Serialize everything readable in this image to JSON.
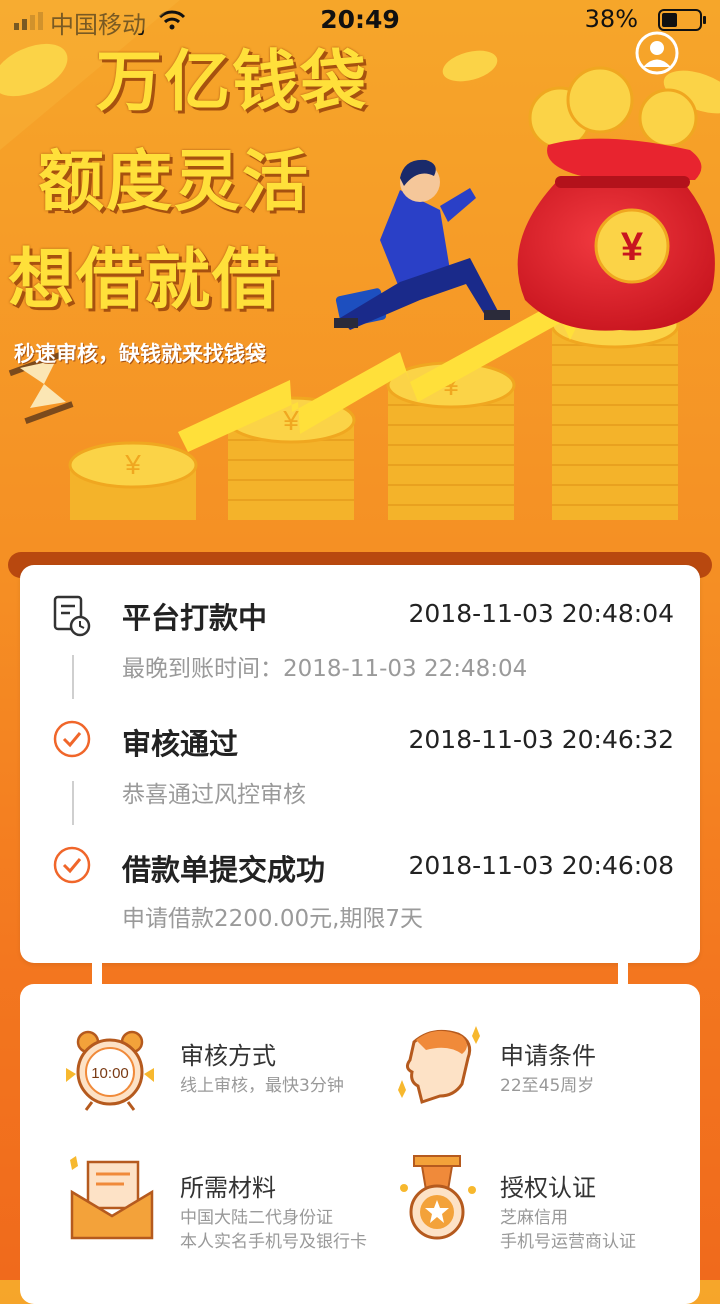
{
  "status_bar": {
    "carrier": "中国移动",
    "time": "20:49",
    "battery": "38%"
  },
  "banner": {
    "line1": "万亿钱袋",
    "line2": "额度灵活",
    "line3": "想借就借",
    "subtitle": "秒速审核，缺钱就来找钱袋",
    "bag_symbol": "¥",
    "coin_symbol": "¥"
  },
  "progress": {
    "steps": [
      {
        "title": "平台打款中",
        "time": "2018-11-03 20:48:04",
        "desc": "最晚到账时间：2018-11-03 22:48:04",
        "icon": "document-clock-icon"
      },
      {
        "title": "审核通过",
        "time": "2018-11-03 20:46:32",
        "desc": "恭喜通过风控审核",
        "icon": "check-circle-icon"
      },
      {
        "title": "借款单提交成功",
        "time": "2018-11-03 20:46:08",
        "desc": "申请借款2200.00元,期限7天",
        "icon": "check-circle-icon"
      }
    ]
  },
  "info": {
    "items": [
      {
        "title": "审核方式",
        "desc1": "线上审核，最快3分钟",
        "desc2": "",
        "icon": "alarm-clock-icon",
        "clock_text": "10:00"
      },
      {
        "title": "申请条件",
        "desc1": "22至45周岁",
        "desc2": "",
        "icon": "person-head-icon"
      },
      {
        "title": "所需材料",
        "desc1": "中国大陆二代身份证",
        "desc2": "本人实名手机号及银行卡",
        "icon": "envelope-letter-icon"
      },
      {
        "title": "授权认证",
        "desc1": "芝麻信用",
        "desc2": "手机号运营商认证",
        "icon": "medal-icon"
      }
    ]
  },
  "colors": {
    "accent": "#f4781f",
    "slogan": "#ffe03a",
    "bag": "#e8242f",
    "coin": "#f8c92e"
  }
}
